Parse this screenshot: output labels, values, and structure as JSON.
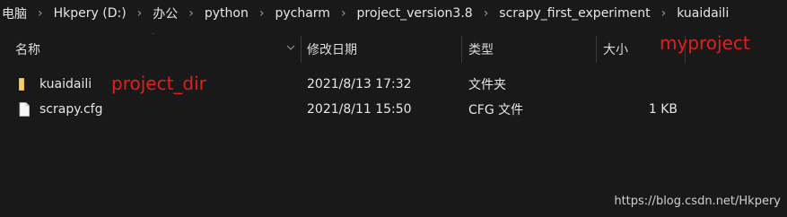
{
  "breadcrumb": [
    "电脑",
    "Hkpery (D:)",
    "办公",
    "python",
    "pycharm",
    "project_version3.8",
    "scrapy_first_experiment",
    "kuaidaili"
  ],
  "columns": {
    "name": "名称",
    "modified": "修改日期",
    "type": "类型",
    "size": "大小"
  },
  "files": [
    {
      "name": "kuaidaili",
      "modified": "2021/8/13 17:32",
      "type": "文件夹",
      "size": "",
      "icon": "folder-icon"
    },
    {
      "name": "scrapy.cfg",
      "modified": "2021/8/11 15:50",
      "type": "CFG 文件",
      "size": "1 KB",
      "icon": "file-icon"
    }
  ],
  "annotations": {
    "project": "myproject",
    "project_dir": "project_dir"
  },
  "watermark": "https://blog.csdn.net/Hkpery",
  "colors": {
    "annotation": "#e0201e",
    "background": "#191919",
    "folder": "#e8b64a"
  }
}
